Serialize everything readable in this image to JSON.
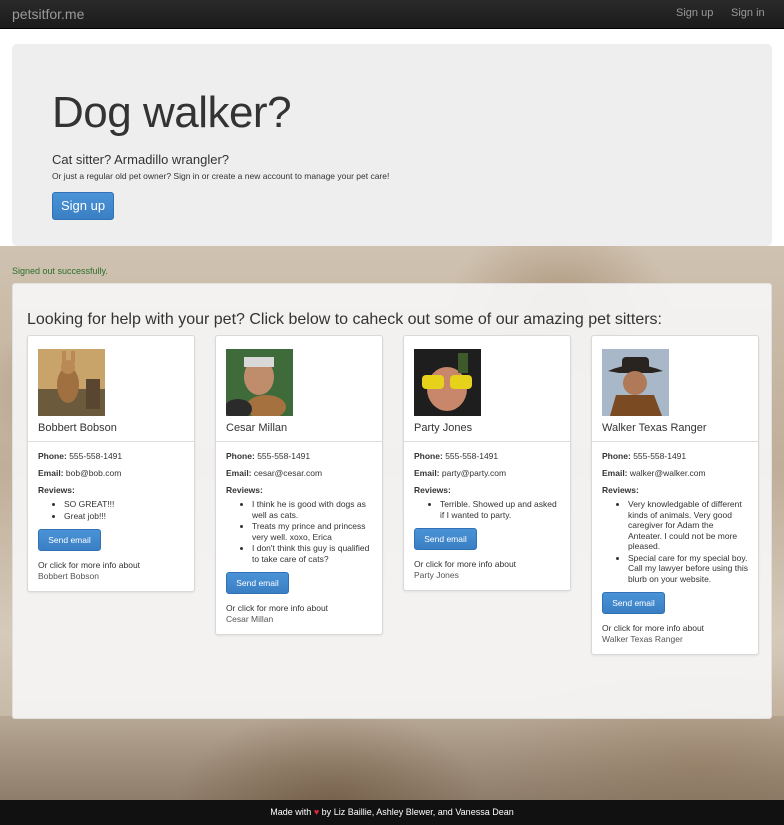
{
  "navbar": {
    "brand": "petsitfor.me",
    "signup": "Sign up",
    "signin": "Sign in"
  },
  "hero": {
    "title": "Dog walker?",
    "subtitle": "Cat sitter? Armadillo wrangler?",
    "tagline": "Or just a regular old pet owner? Sign in or create a new account to manage your pet care!",
    "signup_button": "Sign up"
  },
  "flash": "Signed out successfully.",
  "sitters_heading": "Looking for help with your pet? Click below to caheck out some of our amazing pet sitters:",
  "labels": {
    "phone": "Phone:",
    "email": "Email:",
    "reviews": "Reviews:",
    "send_email": "Send email",
    "more_info": "Or click for more info about"
  },
  "sitters": [
    {
      "name": "Bobbert Bobson",
      "phone": "555-558-1491",
      "email": "bob@bob.com",
      "reviews": [
        "SO GREAT!!!",
        "Great job!!!"
      ]
    },
    {
      "name": "Cesar Millan",
      "phone": "555-558-1491",
      "email": "cesar@cesar.com",
      "reviews": [
        "I think he is good with dogs as well as cats.",
        "Treats my prince and princess very well. xoxo, Erica",
        "I don't think this guy is qualified to take care of cats?"
      ]
    },
    {
      "name": "Party Jones",
      "phone": "555-558-1491",
      "email": "party@party.com",
      "reviews": [
        "Terrible. Showed up and asked if I wanted to party."
      ]
    },
    {
      "name": "Walker Texas Ranger",
      "phone": "555-558-1491",
      "email": "walker@walker.com",
      "reviews": [
        "Very knowledgable of different kinds of animals. Very good caregiver for Adam the Anteater. I could not be more pleased.",
        "Special care for my special boy. Call my lawyer before using this blurb on your website."
      ]
    }
  ],
  "footer": {
    "made_with": "Made with",
    "heart": "♥",
    "by": "by",
    "author1": "Liz Baillie",
    "author2": "Ashley Blewer",
    "and": "and",
    "author3": "Vanessa Dean"
  }
}
